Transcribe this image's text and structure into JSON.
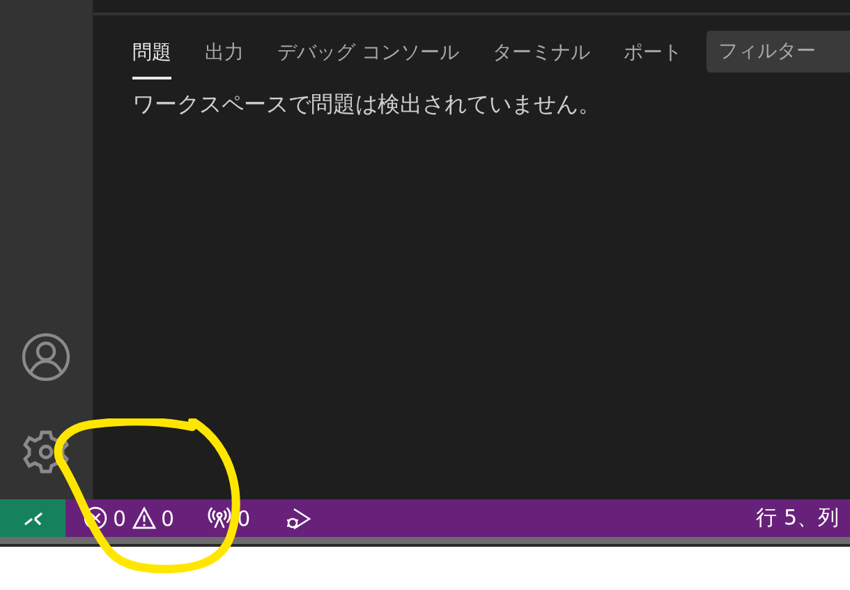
{
  "panel": {
    "tabs": [
      {
        "label": "問題",
        "selected": true
      },
      {
        "label": "出力",
        "selected": false
      },
      {
        "label": "デバッグ コンソール",
        "selected": false
      },
      {
        "label": "ターミナル",
        "selected": false
      },
      {
        "label": "ポート",
        "selected": false
      }
    ],
    "filter": {
      "placeholder": "フィルター"
    },
    "message": "ワークスペースで問題は検出されていません。"
  },
  "status_bar": {
    "errors": "0",
    "warnings": "0",
    "ports": "0",
    "cursor": "行 5、列"
  }
}
